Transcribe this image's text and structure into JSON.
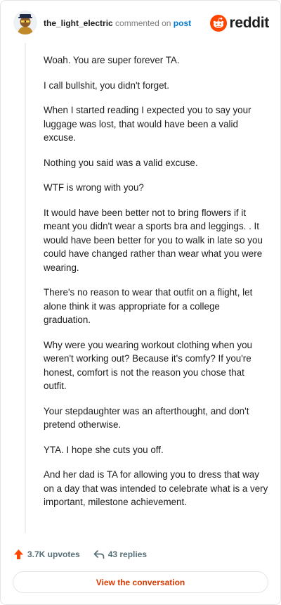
{
  "header": {
    "username": "the_light_electric",
    "verb": "commented on",
    "link": "post",
    "brand": "reddit"
  },
  "comment": {
    "paragraphs": [
      "Woah. You are super forever TA.",
      "I call bullshit, you didn't forget.",
      "When I started reading I expected you to say your luggage was lost, that would have been a valid excuse.",
      "Nothing you said was a valid excuse.",
      "WTF is wrong with you?",
      "It would have been better not to bring flowers if it meant you didn't wear a sports bra and leggings. . It would have been better for you to walk in late so you could have changed rather than wear what you were wearing.",
      "There's no reason to wear that outfit on a flight, let alone think it was appropriate for a college graduation.",
      "Why were you wearing workout clothing when you weren't working out? Because it's comfy? If you're honest, comfort is not the reason you chose that outfit.",
      "Your stepdaughter was an afterthought, and don't pretend otherwise.",
      "YTA. I hope she cuts you off.",
      "And her dad is TA for allowing you to dress that way on a day that was intended to celebrate what is a very important, milestone achievement."
    ]
  },
  "actions": {
    "upvotes": "3.7K upvotes",
    "replies": "43 replies"
  },
  "cta": {
    "label": "View the conversation"
  },
  "colors": {
    "accent": "#ff4500",
    "link": "#0079d3",
    "cta_text": "#d93a00"
  },
  "icons": [
    "avatar",
    "reddit-logo-icon",
    "upvote-arrow-icon",
    "reply-arrow-icon"
  ]
}
